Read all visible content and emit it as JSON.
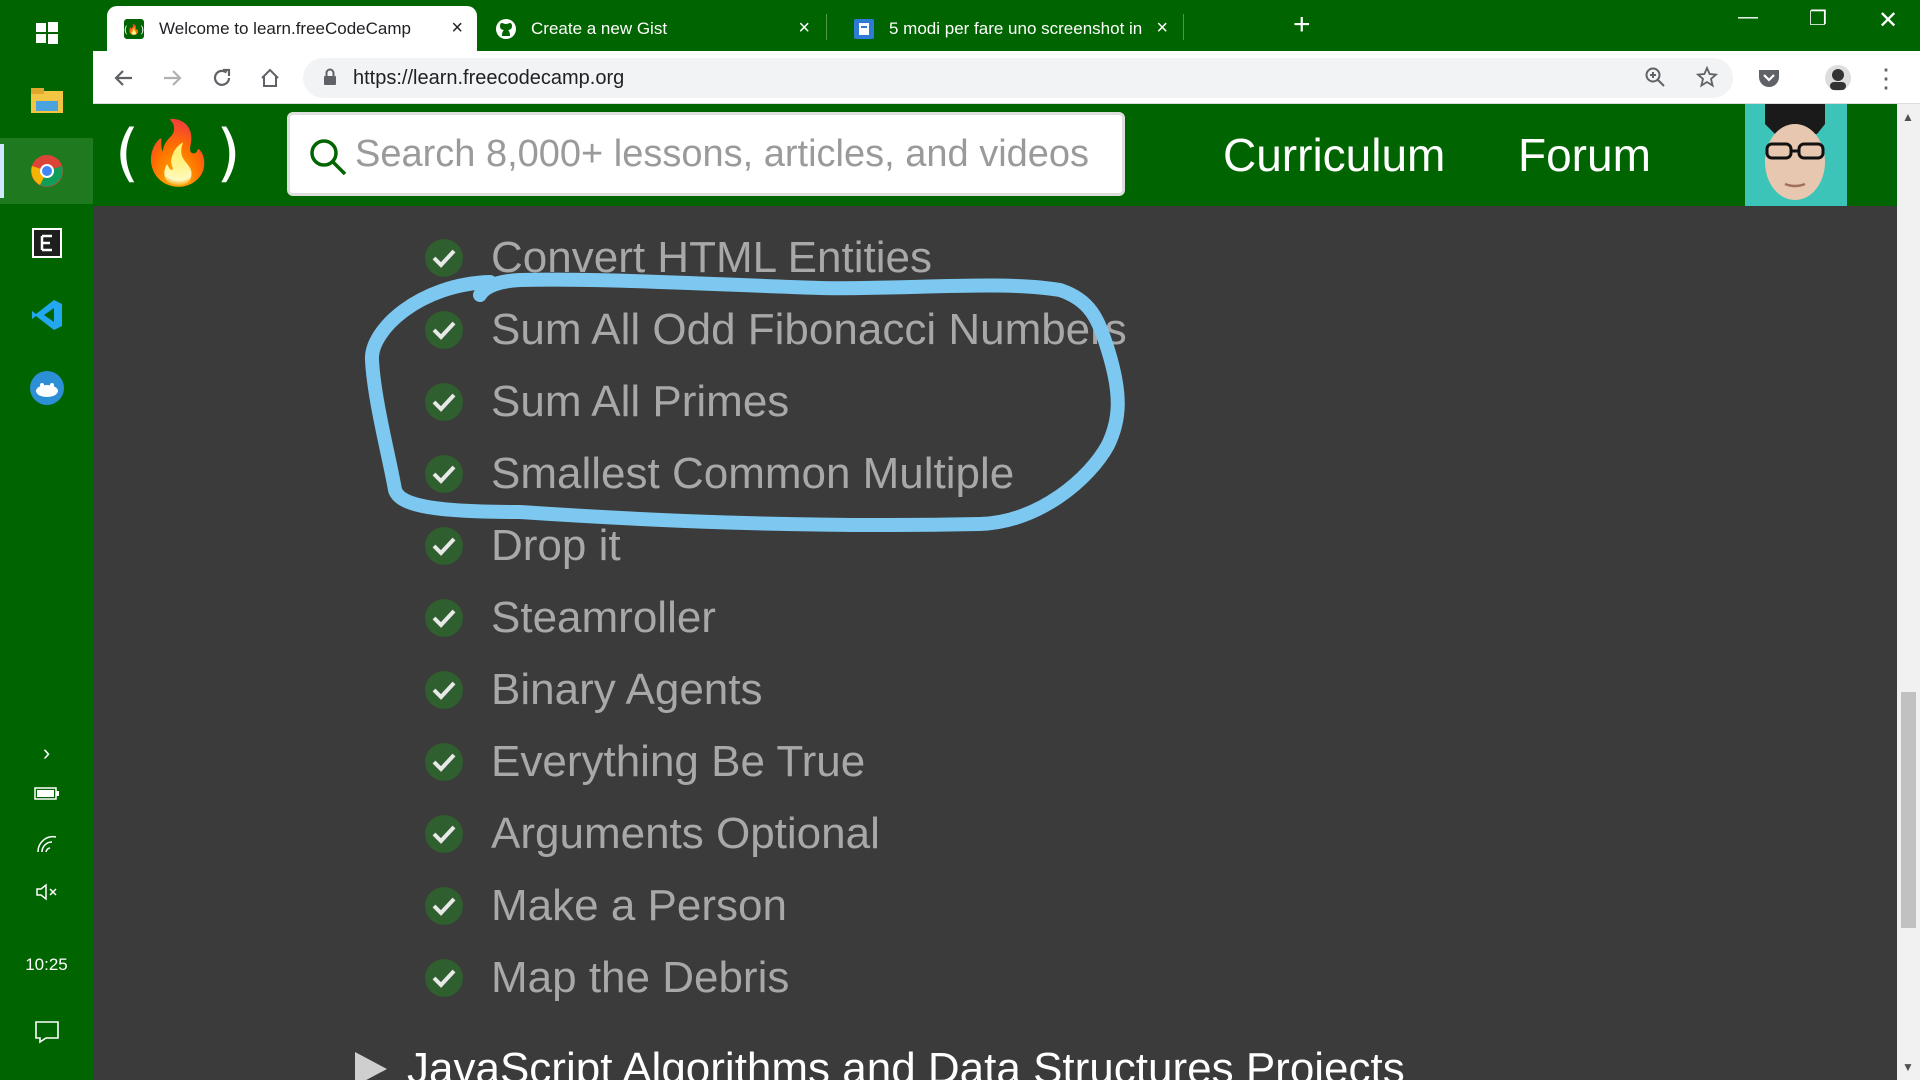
{
  "taskbar": {
    "clock": "10:25",
    "icons": [
      "windows-start-icon",
      "file-explorer-icon",
      "chrome-beta-icon",
      "editor-e-icon",
      "vscode-icon",
      "tunnelbear-icon"
    ]
  },
  "browser": {
    "tabs": [
      {
        "title": "Welcome to learn.freeCodeCamp",
        "favicon": "freecodecamp-favicon"
      },
      {
        "title": "Create a new Gist",
        "favicon": "github-favicon"
      },
      {
        "title": "5 modi per fare uno screenshot in",
        "favicon": "blog-favicon"
      }
    ],
    "url": "https://learn.freecodecamp.org"
  },
  "site": {
    "logo_text": "(🔥)",
    "search_placeholder": "Search 8,000+ lessons, articles, and videos",
    "nav": {
      "curriculum": "Curriculum",
      "forum": "Forum"
    }
  },
  "challenges": [
    "Convert HTML Entities",
    "Sum All Odd Fibonacci Numbers",
    "Sum All Primes",
    "Smallest Common Multiple",
    "Drop it",
    "Steamroller",
    "Binary Agents",
    "Everything Be True",
    "Arguments Optional",
    "Make a Person",
    "Map the Debris"
  ],
  "next_section": "JavaScript Algorithms and Data Structures Projects",
  "colors": {
    "brand_green": "#006400",
    "page_bg": "#3b3b3b",
    "annotation": "#7cc8f0"
  }
}
